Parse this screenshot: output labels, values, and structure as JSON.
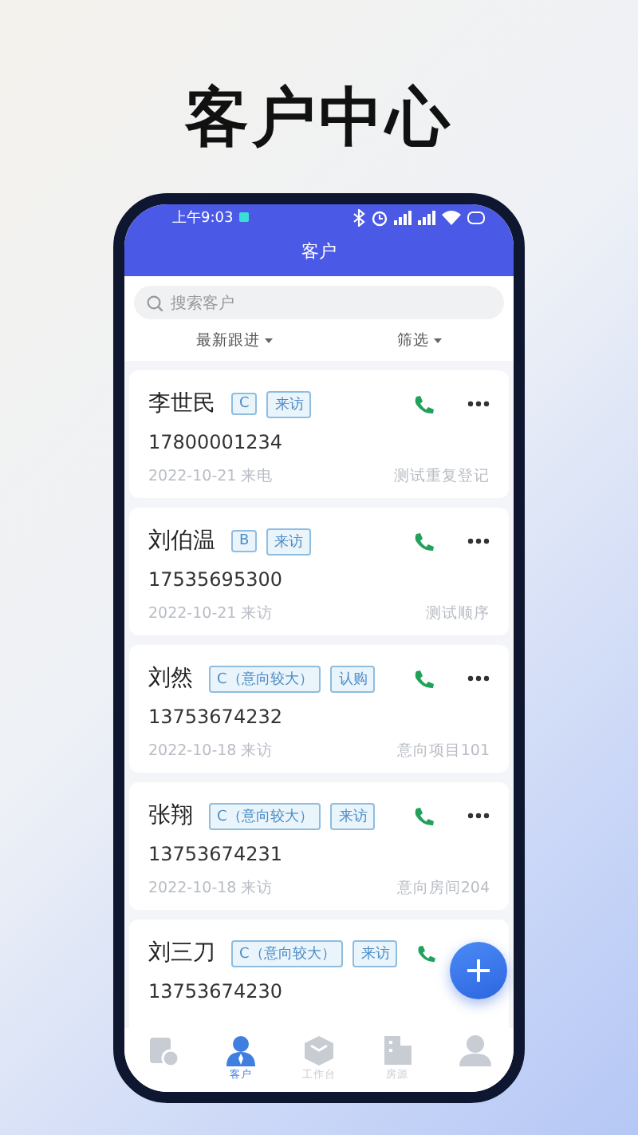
{
  "headline": "客户中心",
  "status_bar": {
    "time": "上午9:03"
  },
  "header": {
    "title": "客户"
  },
  "search": {
    "placeholder": "搜索客户"
  },
  "sort_bar": {
    "items": [
      "最新跟进",
      "筛选"
    ]
  },
  "customers": [
    {
      "name": "李世民",
      "tags": [
        "C",
        "来访"
      ],
      "phone": "17800001234",
      "date": "2022-10-21 来电",
      "note": "测试重复登记"
    },
    {
      "name": "刘伯温",
      "tags": [
        "B",
        "来访"
      ],
      "phone": "17535695300",
      "date": "2022-10-21 来访",
      "note": "测试顺序"
    },
    {
      "name": "刘然",
      "tags": [
        "C（意向较大）",
        "认购"
      ],
      "phone": "13753674232",
      "date": "2022-10-18 来访",
      "note": "意向项目101"
    },
    {
      "name": "张翔",
      "tags": [
        "C（意向较大）",
        "来访"
      ],
      "phone": "13753674231",
      "date": "2022-10-18 来访",
      "note": "意向房间204"
    },
    {
      "name": "刘三刀",
      "tags": [
        "C（意向较大）",
        "来访"
      ],
      "phone": "13753674230"
    }
  ],
  "bottom_nav": [
    {
      "kind": "report",
      "selected": false
    },
    {
      "kind": "person",
      "label": "客户",
      "selected": true
    },
    {
      "kind": "box",
      "label": "工作台",
      "selected": false
    },
    {
      "kind": "building",
      "label": "房源",
      "selected": false
    },
    {
      "kind": "profile",
      "selected": false
    }
  ]
}
